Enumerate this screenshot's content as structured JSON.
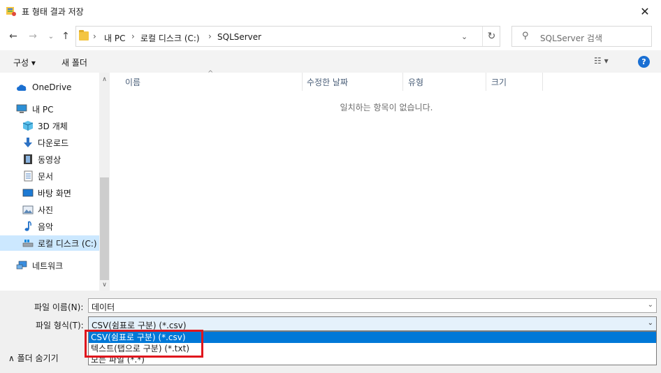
{
  "window": {
    "title": "표 형태 결과 저장",
    "close": "✕"
  },
  "nav": {
    "back": "←",
    "forward": "→",
    "recent": "⌄",
    "up": "↑",
    "breadcrumb": [
      "내 PC",
      "로컬 디스크 (C:)",
      "SQLServer"
    ],
    "sep": "›",
    "dropdown": "⌄",
    "refresh": "↻",
    "search_placeholder": "SQLServer 검색"
  },
  "toolbar": {
    "organize": "구성 ▾",
    "new_folder": "새 폴더",
    "view": "☷ ▾",
    "help": "?"
  },
  "sidebar": {
    "items": [
      {
        "label": "OneDrive"
      },
      {
        "label": "내 PC"
      },
      {
        "label": "3D 개체"
      },
      {
        "label": "다운로드"
      },
      {
        "label": "동영상"
      },
      {
        "label": "문서"
      },
      {
        "label": "바탕 화면"
      },
      {
        "label": "사진"
      },
      {
        "label": "음악"
      },
      {
        "label": "로컬 디스크 (C:)"
      },
      {
        "label": "네트워크"
      }
    ],
    "scroll_up": "∧",
    "scroll_down": "∨"
  },
  "filelist": {
    "columns": [
      "이름",
      "수정한 날짜",
      "유형",
      "크기"
    ],
    "sort_caret": "^",
    "empty_message": "일치하는 항목이 없습니다."
  },
  "form": {
    "filename_label": "파일 이름(N):",
    "filename_value": "데이터",
    "filetype_label": "파일 형식(T):",
    "filetype_value": "CSV(쉼표로 구분) (*.csv)",
    "dd": "⌄",
    "options": [
      "CSV(쉼표로 구분) (*.csv)",
      "텍스트(탭으로 구분) (*.txt)",
      "모든 파일 (*.*)"
    ],
    "hide_folders": "∧  폴더 숨기기"
  },
  "colors": {
    "accent": "#0078d7",
    "highlight": "#e0161d",
    "selected_nav": "#cce8ff"
  }
}
